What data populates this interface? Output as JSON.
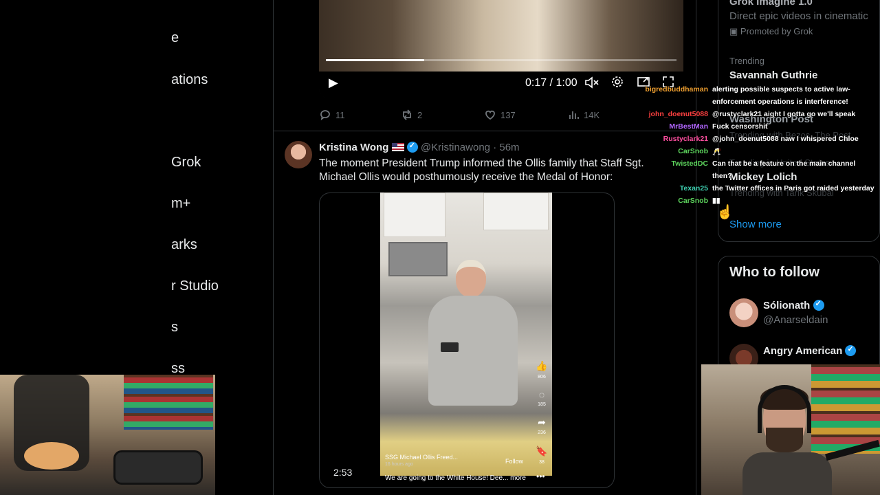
{
  "left_nav": {
    "items": [
      "e",
      "ations",
      "Grok",
      "m+",
      "arks",
      "r Studio",
      "s",
      "ss"
    ]
  },
  "video_player": {
    "time": "0:17 / 1:00",
    "progress": 0.28
  },
  "tweet_actions": {
    "replies": "11",
    "reposts": "2",
    "likes": "137",
    "views": "14K"
  },
  "tweet": {
    "author": "Kristina Wong",
    "handle": "@Kristinawong",
    "time": "· 56m",
    "text": "The moment President Trump informed the Ollis family that Staff Sgt. Michael Ollis would posthumously receive the Medal of Honor:",
    "video_duration": "2:53",
    "embedded": {
      "account": "SSG Michael Ollis Freed...",
      "ago": "16 hours ago",
      "follow": "Follow",
      "caption": "We are going to the White House! Dee... more",
      "counts": [
        "806",
        "185",
        "236",
        "38"
      ]
    }
  },
  "sidebar": {
    "promo_title": "Grok Imagine 1.0",
    "promo_desc": "Direct epic videos in cinematic",
    "promo_by": "Promoted by Grok",
    "trending_label": "Trending",
    "trend1": "Savannah Guthrie",
    "trend2": "Washington Post",
    "trend2_sub": "Trending with Bezos, The Post",
    "trend3_label": "Trending in United States",
    "trend3": "Mickey Lolich",
    "trend3_sub": "Trending with Tarik Skubal",
    "show_more": "Show more",
    "who_to_follow": "Who to follow",
    "follow": [
      {
        "name": "Sólionath",
        "handle": "@Anarseldain"
      },
      {
        "name": "Angry American",
        "handle": ""
      }
    ]
  },
  "chat": [
    {
      "user": "bigredbuddhaman",
      "color": "#f0a030",
      "msg": "alerting possible suspects to active law-"
    },
    {
      "user": "",
      "color": "#ffffff",
      "msg": "enforcement operations is interference!"
    },
    {
      "user": "john_doenut5088",
      "color": "#ff4040",
      "msg": "@rustyclark21 aight I gotta go we'll speak"
    },
    {
      "user": "MrBestMan",
      "color": "#b266ff",
      "msg": "Fuck censorshit"
    },
    {
      "user": "Rustyclark21",
      "color": "#ff4fa0",
      "msg": "@john_doenut5088 naw I whispered Chloe"
    },
    {
      "user": "CarSnob",
      "color": "#5dd45d",
      "msg": "🥂"
    },
    {
      "user": "TwistedDC",
      "color": "#5dd45d",
      "msg": "Can that be a feature on the main channel"
    },
    {
      "user": "",
      "color": "#ffffff",
      "msg": "then?"
    },
    {
      "user": "Texan25",
      "color": "#3ecfb0",
      "msg": "the Twitter offices in Paris got raided yesterday"
    },
    {
      "user": "CarSnob",
      "color": "#5dd45d",
      "msg": "▮▮"
    }
  ],
  "colors": {
    "accent": "#1d9bf0",
    "muted": "#71767b",
    "text": "#e7e9ea",
    "border": "#2f3336"
  }
}
